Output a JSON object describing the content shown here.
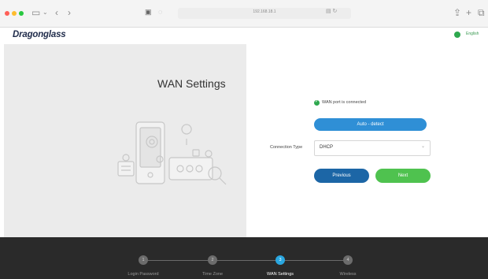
{
  "browser": {
    "address": "192.168.18.1",
    "icons": [
      "sidebar-icon",
      "back-icon",
      "forward-icon",
      "lock-icon",
      "shield-icon",
      "reader-icon",
      "share-icon",
      "new-tab-icon",
      "tabs-icon"
    ]
  },
  "app": {
    "brand": "Dragonglass",
    "language": "English",
    "accent": "#2aa7e0"
  },
  "left_panel": {
    "title": "WAN Settings"
  },
  "form": {
    "status": "WAN port is connected",
    "auto_detect_label": "Auto - detect",
    "connection_type_label": "Connection Type",
    "connection_type_value": "DHCP",
    "previous_label": "Previous",
    "next_label": "Next"
  },
  "stepper": {
    "current": 3,
    "steps": [
      {
        "number": "1",
        "label": "Login Password"
      },
      {
        "number": "2",
        "label": "Time Zone"
      },
      {
        "number": "3",
        "label": "WAN Settings"
      },
      {
        "number": "4",
        "label": "Wireless"
      }
    ]
  }
}
